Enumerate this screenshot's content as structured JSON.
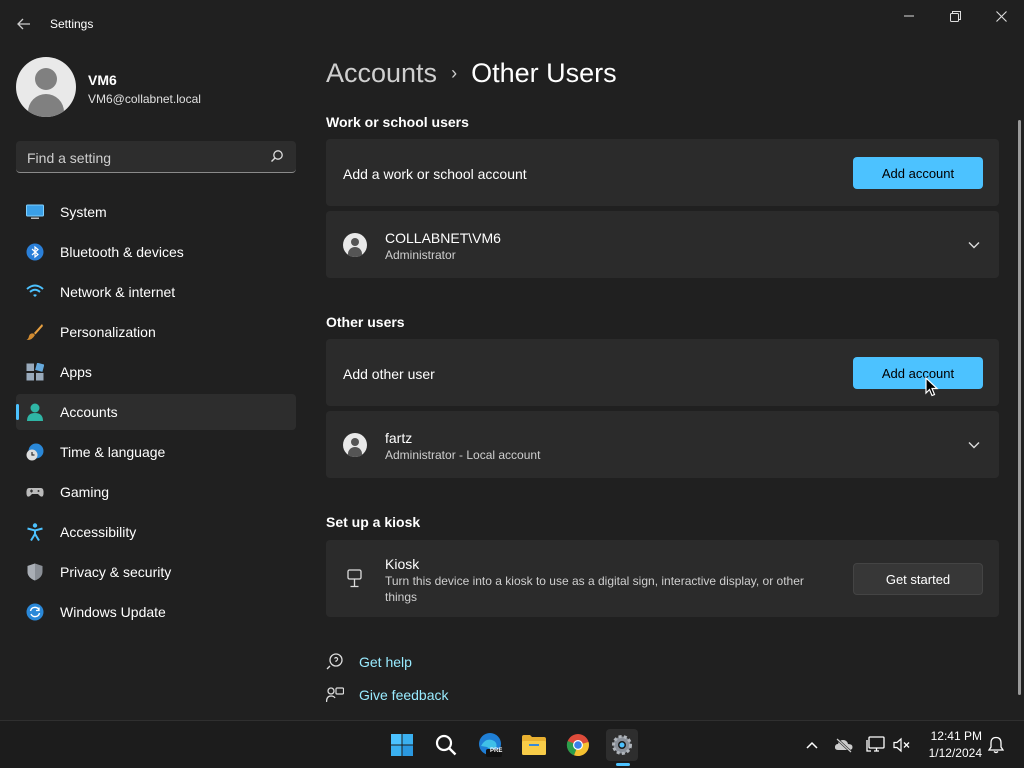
{
  "window": {
    "title": "Settings"
  },
  "profile": {
    "name": "VM6",
    "email": "VM6@collabnet.local"
  },
  "search": {
    "placeholder": "Find a setting"
  },
  "sidebar": {
    "items": [
      {
        "label": "System",
        "icon": "monitor-icon"
      },
      {
        "label": "Bluetooth & devices",
        "icon": "bluetooth-icon"
      },
      {
        "label": "Network & internet",
        "icon": "wifi-icon"
      },
      {
        "label": "Personalization",
        "icon": "brush-icon"
      },
      {
        "label": "Apps",
        "icon": "apps-icon"
      },
      {
        "label": "Accounts",
        "icon": "person-icon",
        "active": true
      },
      {
        "label": "Time & language",
        "icon": "globe-clock-icon"
      },
      {
        "label": "Gaming",
        "icon": "gamepad-icon"
      },
      {
        "label": "Accessibility",
        "icon": "accessibility-icon"
      },
      {
        "label": "Privacy & security",
        "icon": "shield-icon"
      },
      {
        "label": "Windows Update",
        "icon": "update-icon"
      }
    ]
  },
  "breadcrumb": {
    "parent": "Accounts",
    "separator": "›",
    "current": "Other Users"
  },
  "work_school": {
    "title": "Work or school users",
    "add_label": "Add a work or school account",
    "add_button": "Add account",
    "user": {
      "name": "COLLABNET\\VM6",
      "role": "Administrator"
    }
  },
  "other_users": {
    "title": "Other users",
    "add_label": "Add other user",
    "add_button": "Add account",
    "user": {
      "name": "fartz",
      "role": "Administrator - Local account"
    }
  },
  "kiosk": {
    "title": "Set up a kiosk",
    "name": "Kiosk",
    "description": "Turn this device into a kiosk to use as a digital sign, interactive display, or other",
    "description2": "things",
    "button": "Get started"
  },
  "links": {
    "help": "Get help",
    "feedback": "Give feedback"
  },
  "taskbar": {
    "edge_badge": "PRE",
    "time": "12:41 PM",
    "date": "1/12/2024"
  },
  "colors": {
    "accent": "#4cc2ff",
    "background": "#202020",
    "card": "#2b2b2b",
    "link": "#99ebff"
  }
}
